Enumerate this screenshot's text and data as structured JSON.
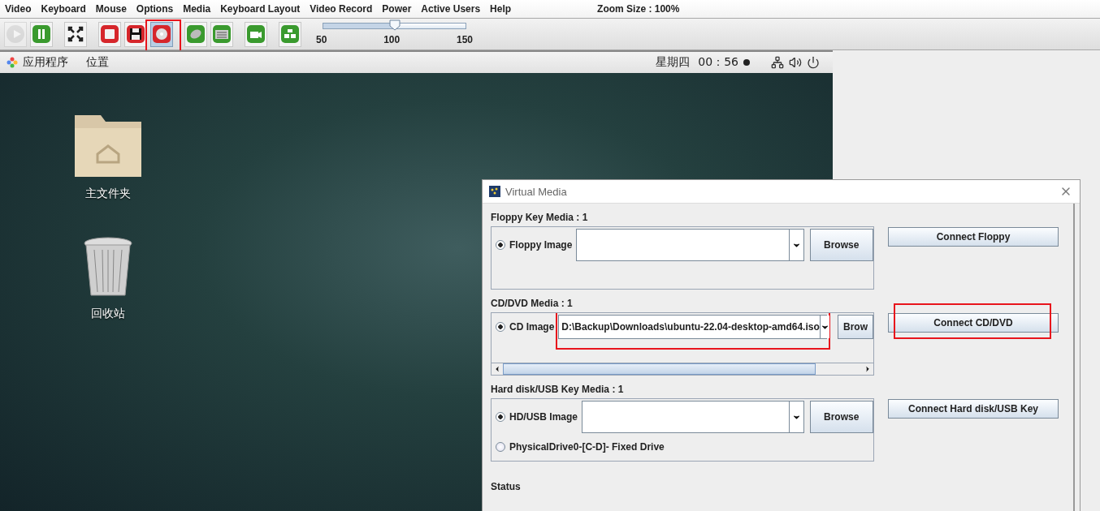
{
  "menu": [
    "Video",
    "Keyboard",
    "Mouse",
    "Options",
    "Media",
    "Keyboard Layout",
    "Video Record",
    "Power",
    "Active Users",
    "Help"
  ],
  "zoom_size": "Zoom Size : 100%",
  "toolbar": [
    {
      "buttons": [
        {
          "kind": "play",
          "disabled": true,
          "selected": false,
          "highlighted": false
        },
        {
          "kind": "pause",
          "disabled": false,
          "selected": false,
          "highlighted": false
        }
      ]
    },
    {
      "buttons": [
        {
          "kind": "fullscreen",
          "disabled": false,
          "selected": false,
          "highlighted": false
        }
      ]
    },
    {
      "buttons": [
        {
          "kind": "drive",
          "disabled": false,
          "selected": false,
          "highlighted": false
        },
        {
          "kind": "floppy",
          "disabled": false,
          "selected": false,
          "highlighted": false
        },
        {
          "kind": "cd",
          "disabled": false,
          "selected": true,
          "highlighted": true
        }
      ]
    },
    {
      "buttons": [
        {
          "kind": "mouse",
          "disabled": false,
          "selected": false,
          "highlighted": false
        },
        {
          "kind": "keyboard",
          "disabled": false,
          "selected": false,
          "highlighted": false
        }
      ]
    },
    {
      "buttons": [
        {
          "kind": "camera",
          "disabled": false,
          "selected": false,
          "highlighted": false
        }
      ]
    },
    {
      "buttons": [
        {
          "kind": "users",
          "disabled": false,
          "selected": false,
          "highlighted": false
        }
      ]
    }
  ],
  "zoom_slider": {
    "level": 0.5,
    "ticks": [
      "50",
      "100",
      "150"
    ]
  },
  "desktop_panel": {
    "menus": [
      "应用程序",
      "位置"
    ],
    "day": "星期四",
    "time": "00：56"
  },
  "desktop_icons": [
    {
      "kind": "folder",
      "label": "主文件夹"
    },
    {
      "kind": "trash",
      "label": "回收站"
    }
  ],
  "dialog": {
    "title": "Virtual Media",
    "sections": [
      {
        "title": "Floppy Key Media : 1",
        "scrollbar": false,
        "connect": {
          "label": "Connect Floppy",
          "highlighted": false
        },
        "options": [
          {
            "kind": "image",
            "label": "Floppy Image",
            "selected": true,
            "browse": "Browse",
            "highlighted": false
          }
        ]
      },
      {
        "title": "CD/DVD Media : 1",
        "scrollbar": true,
        "connect": {
          "label": "Connect CD/DVD",
          "highlighted": true
        },
        "options": [
          {
            "kind": "image",
            "label": "CD Image",
            "selected": true,
            "path": "D:\\Backup\\Downloads\\ubuntu-22.04-desktop-amd64.iso",
            "browse": "Brow",
            "highlighted": true
          }
        ]
      },
      {
        "title": "Hard disk/USB Key Media : 1",
        "scrollbar": false,
        "connect": {
          "label": "Connect Hard disk/USB Key",
          "highlighted": false
        },
        "options": [
          {
            "kind": "image",
            "label": "HD/USB Image",
            "selected": true,
            "browse": "Browse",
            "highlighted": false
          },
          {
            "kind": "drive",
            "label": "PhysicalDrive0-[C-D]- Fixed Drive",
            "selected": false
          }
        ]
      }
    ],
    "status": "Status"
  }
}
